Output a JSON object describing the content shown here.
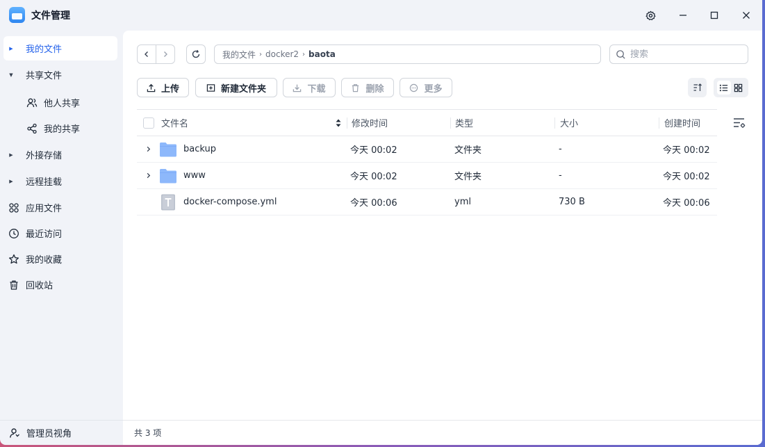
{
  "window": {
    "title": "文件管理"
  },
  "sidebar": {
    "items": [
      {
        "label": "我的文件"
      },
      {
        "label": "共享文件"
      },
      {
        "label": "他人共享"
      },
      {
        "label": "我的共享"
      },
      {
        "label": "外接存储"
      },
      {
        "label": "远程挂载"
      },
      {
        "label": "应用文件"
      },
      {
        "label": "最近访问"
      },
      {
        "label": "我的收藏"
      },
      {
        "label": "回收站"
      }
    ],
    "footer_label": "管理员视角"
  },
  "breadcrumb": {
    "items": [
      "我的文件",
      "docker2",
      "baota"
    ]
  },
  "search": {
    "placeholder": "搜索"
  },
  "toolbar": {
    "upload": "上传",
    "new_folder": "新建文件夹",
    "download": "下载",
    "delete": "删除",
    "more": "更多"
  },
  "table": {
    "columns": [
      "文件名",
      "修改时间",
      "类型",
      "大小",
      "创建时间"
    ],
    "rows": [
      {
        "name": "backup",
        "modified": "今天 00:02",
        "type": "文件夹",
        "size": "-",
        "created": "今天 00:02",
        "kind": "folder"
      },
      {
        "name": "www",
        "modified": "今天 00:02",
        "type": "文件夹",
        "size": "-",
        "created": "今天 00:02",
        "kind": "folder"
      },
      {
        "name": "docker-compose.yml",
        "modified": "今天 00:06",
        "type": "yml",
        "size": "730 B",
        "created": "今天 00:06",
        "kind": "file"
      }
    ]
  },
  "status": {
    "count_text": "共 3 项"
  },
  "colors": {
    "accent": "#2563eb",
    "folder": "#8db8fb",
    "sidebar_bg": "#f1f3f8"
  }
}
